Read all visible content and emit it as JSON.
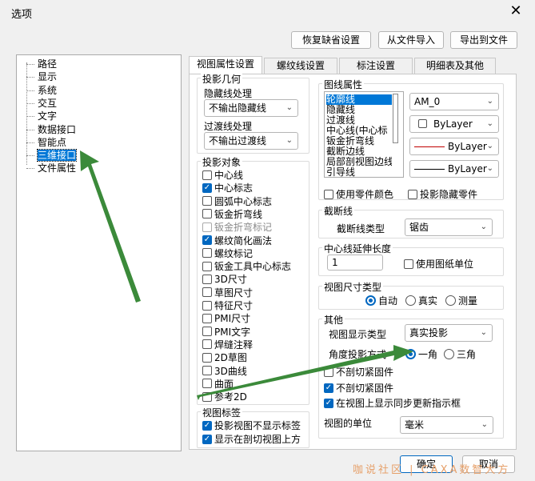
{
  "window": {
    "title": "选项",
    "close_icon": "✕"
  },
  "top_buttons": {
    "restore": "恢复缺省设置",
    "from_file": "从文件导入",
    "export": "导出到文件"
  },
  "tree": {
    "items": [
      "路径",
      "显示",
      "系统",
      "交互",
      "文字",
      "数据接口",
      "智能点",
      "三维接口",
      "文件属性"
    ],
    "selected": "三维接口"
  },
  "tabs": [
    "视图属性设置",
    "螺纹线设置",
    "标注设置",
    "明细表及其他"
  ],
  "projection_geometry": {
    "title": "投影几何",
    "hidden_label": "隐藏线处理",
    "hidden_value": "不输出隐藏线",
    "transition_label": "过渡线处理",
    "transition_value": "不输出过渡线"
  },
  "projection_objects": {
    "title": "投影对象",
    "items": [
      {
        "label": "中心线",
        "checked": false,
        "disabled": false
      },
      {
        "label": "中心标志",
        "checked": true,
        "disabled": false
      },
      {
        "label": "圆弧中心标志",
        "checked": false,
        "disabled": false
      },
      {
        "label": "钣金折弯线",
        "checked": false,
        "disabled": false
      },
      {
        "label": "钣金折弯标记",
        "checked": false,
        "disabled": true
      },
      {
        "label": "螺纹简化画法",
        "checked": true,
        "disabled": false
      },
      {
        "label": "螺纹标记",
        "checked": false,
        "disabled": false
      },
      {
        "label": "钣金工具中心标志",
        "checked": false,
        "disabled": false
      },
      {
        "label": "3D尺寸",
        "checked": false,
        "disabled": false
      },
      {
        "label": "草图尺寸",
        "checked": false,
        "disabled": false
      },
      {
        "label": "特征尺寸",
        "checked": false,
        "disabled": false
      },
      {
        "label": "PMI尺寸",
        "checked": false,
        "disabled": false
      },
      {
        "label": "PMI文字",
        "checked": false,
        "disabled": false
      },
      {
        "label": "焊缝注释",
        "checked": false,
        "disabled": false
      },
      {
        "label": "2D草图",
        "checked": false,
        "disabled": false
      },
      {
        "label": "3D曲线",
        "checked": false,
        "disabled": false
      },
      {
        "label": "曲面",
        "checked": false,
        "disabled": false
      },
      {
        "label": "参考2D",
        "checked": false,
        "disabled": false
      }
    ]
  },
  "view_label": {
    "title": "视图标签",
    "items": [
      {
        "label": "投影视图不显示标签",
        "checked": true
      },
      {
        "label": "显示在剖切视图上方",
        "checked": true
      }
    ]
  },
  "line_props": {
    "title": "图线属性",
    "list": [
      "轮廓线",
      "隐藏线",
      "过渡线",
      "中心线(中心标",
      "钣金折弯线",
      "截断边线",
      "局部剖视图边线",
      "引导线"
    ],
    "selected": "轮廓线",
    "layer": "AM_0",
    "color": "ByLayer",
    "linetype": "ByLayer",
    "lineweight": "ByLayer",
    "use_part_color": "使用零件颜色",
    "projection_hidden_part": "投影隐藏零件"
  },
  "break_line": {
    "title": "截断线",
    "type_label": "截断线类型",
    "type_value": "锯齿"
  },
  "centerline_ext": {
    "title": "中心线延伸长度",
    "value": "1",
    "use_sheet_unit": "使用图纸单位"
  },
  "dim_type": {
    "title": "视图尺寸类型",
    "options": [
      "自动",
      "真实",
      "测量"
    ],
    "selected": "自动"
  },
  "other": {
    "title": "其他",
    "display_type_label": "视图显示类型",
    "display_type_value": "真实投影",
    "angle_label": "角度投影方式",
    "angle_options": [
      "一角",
      "三角"
    ],
    "angle_selected": "一角",
    "no_section_fasteners": {
      "label": "不剖切紧固件",
      "checked": false
    },
    "no_cut_fasteners": {
      "label": "不剖切紧固件",
      "checked": true
    },
    "show_sync": {
      "label": "在视图上显示同步更新指示框",
      "checked": true
    },
    "unit_label": "视图的单位",
    "unit_value": "毫米"
  },
  "bottom": {
    "ok": "确定",
    "cancel": "取消",
    "watermark": "咖说社区 | CAXA数智大方"
  },
  "colors": {
    "accent": "#0067c0",
    "selection": "#0078d7",
    "arrow": "#3b8a3a",
    "red_line": "#c00000"
  },
  "icons": {
    "check": "✓",
    "dropdown": "⌄"
  }
}
